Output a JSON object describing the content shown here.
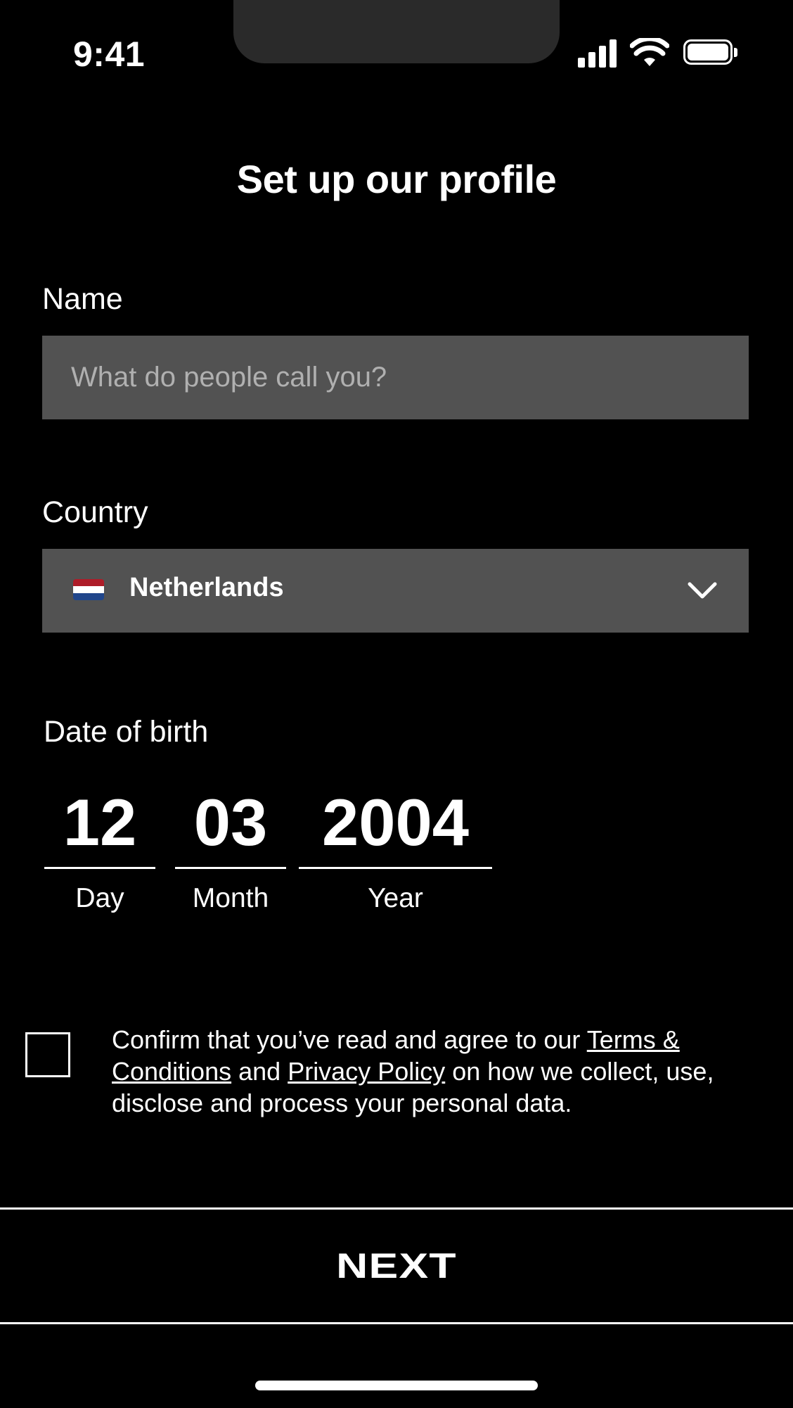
{
  "status_bar": {
    "time": "9:41"
  },
  "title": "Set up our profile",
  "name_field": {
    "label": "Name",
    "placeholder": "What do people call you?"
  },
  "country_field": {
    "label": "Country",
    "value": "Netherlands",
    "flag_colors": [
      "#AE1C28",
      "#FFFFFF",
      "#21468B"
    ]
  },
  "dob": {
    "label": "Date of birth",
    "day": {
      "value": "12",
      "caption": "Day"
    },
    "month": {
      "value": "03",
      "caption": "Month"
    },
    "year": {
      "value": "2004",
      "caption": "Year"
    }
  },
  "consent": {
    "text_before": "Confirm that you’ve read and agree to our ",
    "terms_link": "Terms & Conditions",
    "text_mid": " and ",
    "privacy_link": "Privacy Policy",
    "text_after": " on how we collect, use, disclose and process your personal data."
  },
  "next_button": {
    "label": "NEXT"
  },
  "colors": {
    "background": "#000000",
    "field_bg": "#525252",
    "placeholder": "#B0B0B0",
    "text": "#FFFFFF"
  }
}
